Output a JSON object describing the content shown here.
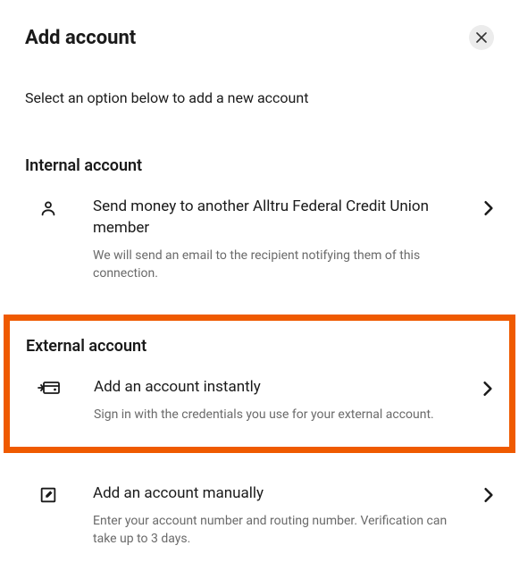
{
  "header": {
    "title": "Add account"
  },
  "subtitle": "Select an option below to add a new account",
  "internal": {
    "heading": "Internal account",
    "option": {
      "title": "Send money to another Alltru Federal Credit Union member",
      "desc": "We will send an email to the recipient notifying them of this connection."
    }
  },
  "external": {
    "heading": "External account",
    "instant": {
      "title": "Add an account instantly",
      "desc": "Sign in with the credentials you use for your external account."
    },
    "manual": {
      "title": "Add an account manually",
      "desc": "Enter your account number and routing number. Verification can take up to 3 days."
    }
  }
}
